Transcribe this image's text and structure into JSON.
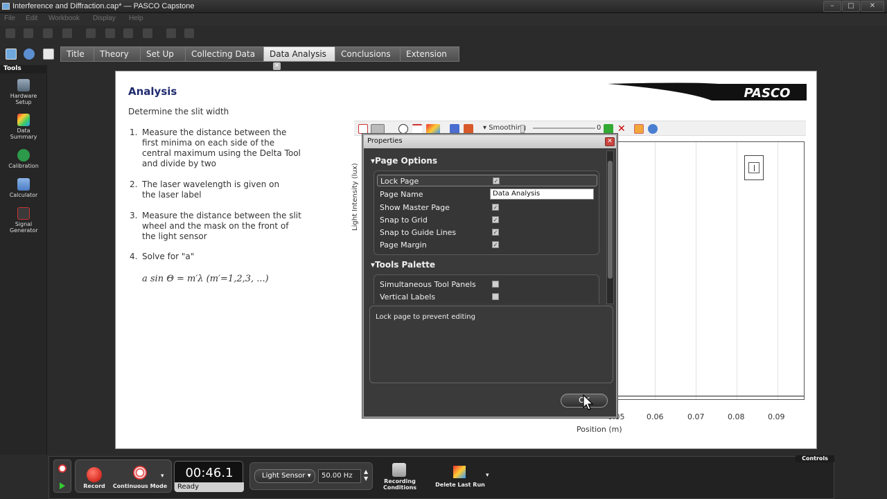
{
  "window": {
    "title": "Interference and Diffraction.cap* — PASCO Capstone"
  },
  "menu": [
    "File",
    "Edit",
    "Workbook",
    "Display",
    "Help"
  ],
  "tabs": [
    {
      "label": "Title"
    },
    {
      "label": "Theory"
    },
    {
      "label": "Set Up"
    },
    {
      "label": "Collecting Data"
    },
    {
      "label": "Data Analysis",
      "active": true
    },
    {
      "label": "Conclusions"
    },
    {
      "label": "Extension"
    }
  ],
  "tools_palette": {
    "header": "Tools",
    "items": [
      {
        "label": "Hardware Setup",
        "icon": "hardware-setup-icon"
      },
      {
        "label": "Data Summary",
        "icon": "data-summary-icon"
      },
      {
        "label": "Calibration",
        "icon": "calibration-icon"
      },
      {
        "label": "Calculator",
        "icon": "calculator-icon"
      },
      {
        "label": "Signal Generator",
        "icon": "signal-generator-icon"
      }
    ]
  },
  "page": {
    "title": "Analysis",
    "subtitle": "Determine the slit width",
    "logo_text": "PASCO",
    "steps": [
      {
        "num": "1.",
        "text": "Measure the distance between the first minima on each side of the central maximum using the Delta Tool and divide by two"
      },
      {
        "num": "2.",
        "text": "The laser wavelength is given on the laser label"
      },
      {
        "num": "3.",
        "text": "Measure the distance between the slit wheel and the mask on the front of the light sensor"
      },
      {
        "num": "4.",
        "text": "Solve for \"a\""
      }
    ],
    "formula": "a sin Θ = m′λ (m′=1,2,3, ...)",
    "graph": {
      "smoothing_label": "Smoothing",
      "smoothing_value": "0",
      "y_label": "Light Intensity (lux)",
      "x_label": "Position (m)",
      "x_ticks": [
        "0.05",
        "0.06",
        "0.07",
        "0.08",
        "0.09"
      ]
    }
  },
  "dialog": {
    "title": "Properties",
    "page_options_label": "Page Options",
    "page_options": [
      {
        "label": "Lock Page",
        "type": "check",
        "checked": true
      },
      {
        "label": "Page Name",
        "type": "text",
        "value": "Data Analysis"
      },
      {
        "label": "Show Master Page",
        "type": "check",
        "checked": true
      },
      {
        "label": "Snap to Grid",
        "type": "check",
        "checked": true
      },
      {
        "label": "Snap to Guide Lines",
        "type": "check",
        "checked": true
      },
      {
        "label": "Page Margin",
        "type": "check",
        "checked": true
      }
    ],
    "tools_palette_label": "Tools Palette",
    "tools_palette_options": [
      {
        "label": "Simultaneous Tool Panels",
        "checked": false
      },
      {
        "label": "Vertical Labels",
        "checked": false
      }
    ],
    "description": "Lock page to prevent editing",
    "ok_label": "OK"
  },
  "controls": {
    "header": "Controls",
    "record_label": "Record",
    "mode_label": "Continuous Mode",
    "timer_value": "00:46.1",
    "timer_status": "Ready",
    "sensor": "Light Sensor",
    "rate": "50.00 Hz",
    "recording_conditions_label": "Recording Conditions",
    "delete_run_label": "Delete Last Run"
  },
  "colors": {
    "accent_title": "#1f2a6e",
    "record_red": "#e0362c",
    "close_red": "#c9453f"
  }
}
